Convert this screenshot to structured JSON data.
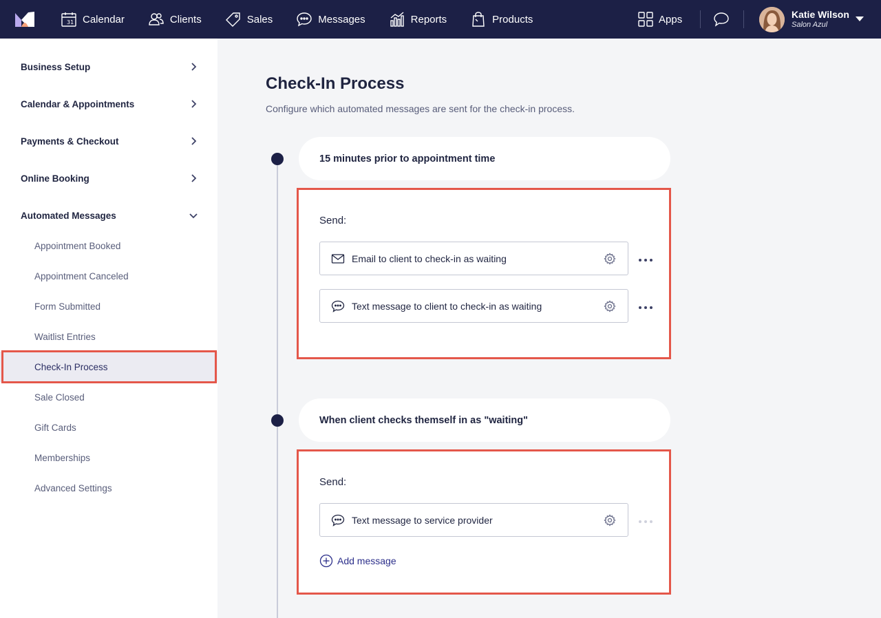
{
  "nav": {
    "items": [
      {
        "label": "Calendar",
        "icon": "calendar-icon"
      },
      {
        "label": "Clients",
        "icon": "clients-icon"
      },
      {
        "label": "Sales",
        "icon": "tag-icon"
      },
      {
        "label": "Messages",
        "icon": "message-bubble-icon"
      },
      {
        "label": "Reports",
        "icon": "bar-chart-icon"
      },
      {
        "label": "Products",
        "icon": "bag-icon"
      }
    ],
    "apps_label": "Apps",
    "user_name": "Katie Wilson",
    "user_salon": "Salon Azul",
    "brand_color": "#1c2046"
  },
  "sidebar": {
    "sections": [
      {
        "label": "Business Setup",
        "expanded": false
      },
      {
        "label": "Calendar & Appointments",
        "expanded": false
      },
      {
        "label": "Payments & Checkout",
        "expanded": false
      },
      {
        "label": "Online Booking",
        "expanded": false
      },
      {
        "label": "Automated Messages",
        "expanded": true
      }
    ],
    "subitems": [
      {
        "label": "Appointment Booked"
      },
      {
        "label": "Appointment Canceled"
      },
      {
        "label": "Form Submitted"
      },
      {
        "label": "Waitlist Entries"
      },
      {
        "label": "Check-In Process",
        "active": true
      },
      {
        "label": "Sale Closed"
      },
      {
        "label": "Gift Cards"
      },
      {
        "label": "Memberships"
      },
      {
        "label": "Advanced Settings"
      }
    ]
  },
  "main": {
    "title": "Check-In Process",
    "subtitle": "Configure which automated messages are sent for the check-in process.",
    "steps": [
      {
        "trigger": "15 minutes prior to appointment time",
        "send_label": "Send:",
        "messages": [
          {
            "label": "Email to client to check-in as waiting",
            "icon": "envelope-icon"
          },
          {
            "label": "Text message to client to check-in as waiting",
            "icon": "chat-bubble-icon"
          }
        ]
      },
      {
        "trigger": "When client checks themself in as \"waiting\"",
        "send_label": "Send:",
        "messages": [
          {
            "label": "Text message to service provider",
            "icon": "chat-bubble-icon"
          }
        ],
        "add_label": "Add message"
      }
    ],
    "highlight_color": "#e4574a"
  }
}
